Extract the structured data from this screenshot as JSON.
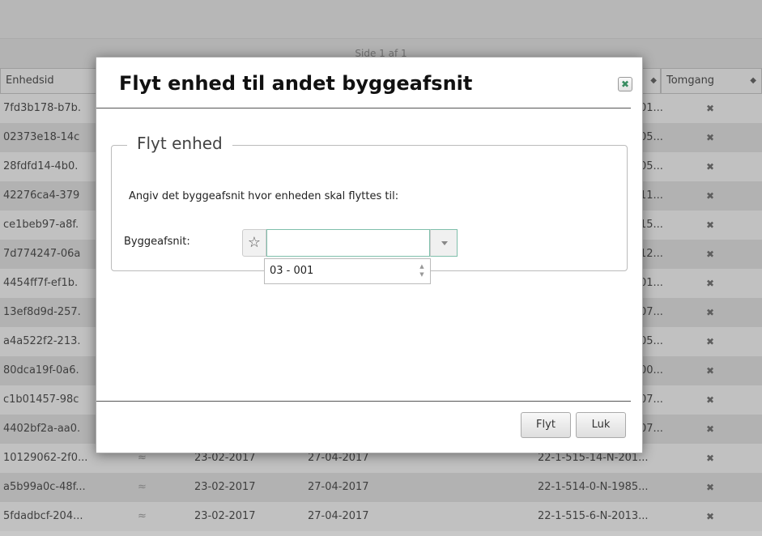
{
  "pager": {
    "text": "Side 1 af 1"
  },
  "columns": {
    "enhedsid": "Enhedsid",
    "tomgang": "Tomgang"
  },
  "sort_icon": "sort-icon",
  "rows": [
    {
      "id": "7fd3b178-b7b.",
      "right": "01...",
      "tom": "✖"
    },
    {
      "id": "02373e18-14c",
      "right": "05...",
      "tom": "✖"
    },
    {
      "id": "28fdfd14-4b0.",
      "right": "05...",
      "tom": "✖"
    },
    {
      "id": "42276ca4-379",
      "right": "11...",
      "tom": "✖"
    },
    {
      "id": "ce1beb97-a8f.",
      "right": "15...",
      "tom": "✖"
    },
    {
      "id": "7d774247-06a",
      "right": "12...",
      "tom": "✖"
    },
    {
      "id": "4454ff7f-ef1b.",
      "right": "01...",
      "tom": "✖"
    },
    {
      "id": "13ef8d9d-257.",
      "right": "07...",
      "tom": "✖"
    },
    {
      "id": "a4a522f2-213.",
      "right": "05...",
      "tom": "✖"
    },
    {
      "id": "80dca19f-0a6.",
      "right": "00...",
      "tom": "✖"
    },
    {
      "id": "c1b01457-98c",
      "right": "07...",
      "tom": "✖"
    },
    {
      "id": "4402bf2a-aa0.",
      "right": "07...",
      "tom": "✖"
    },
    {
      "id": "10129062-2f0...",
      "icon": "rss-icon",
      "d1": "23-02-2017",
      "d2": "27-04-2017",
      "code": "22-1-515-14-N-201...",
      "tom": "✖"
    },
    {
      "id": "a5b99a0c-48f...",
      "icon": "rss-icon",
      "d1": "23-02-2017",
      "d2": "27-04-2017",
      "code": "22-1-514-0-N-1985...",
      "tom": "✖"
    },
    {
      "id": "5fdadbcf-204...",
      "icon": "rss-icon",
      "d1": "23-02-2017",
      "d2": "27-04-2017",
      "code": "22-1-515-6-N-2013...",
      "tom": "✖"
    }
  ],
  "modal": {
    "title": "Flyt enhed til andet byggeafsnit",
    "close_icon": "close-icon",
    "close_glyph": "✖",
    "legend": "Flyt enhed",
    "instruction": "Angiv det byggeafsnit hvor enheden skal flyttes til:",
    "field_label": "Byggeafsnit:",
    "star_glyph": "☆",
    "input_value": "",
    "dropdown_option": "03 - 001",
    "move_button": "Flyt",
    "close_button": "Luk"
  },
  "colors": {
    "accent": "#3a8d62",
    "focus_border": "#7fbfab"
  }
}
